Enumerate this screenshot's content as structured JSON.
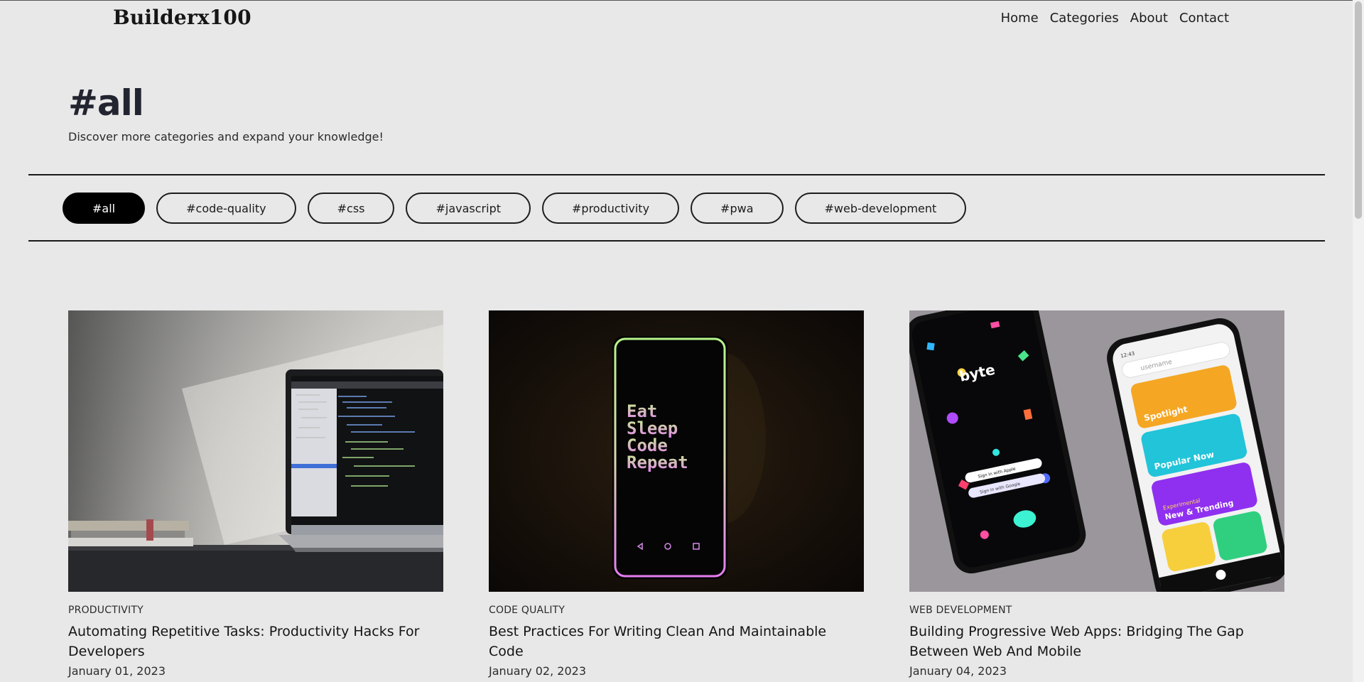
{
  "brand": "Builderx100",
  "nav": {
    "home": "Home",
    "categories": "Categories",
    "about": "About",
    "contact": "Contact"
  },
  "header": {
    "title": "#all",
    "subtitle": "Discover more categories and expand your knowledge!"
  },
  "tags": [
    "#all",
    "#code-quality",
    "#css",
    "#javascript",
    "#productivity",
    "#pwa",
    "#web-development"
  ],
  "cards": [
    {
      "category": "PRODUCTIVITY",
      "title": "Automating Repetitive Tasks: Productivity Hacks For Developers",
      "date": "January 01, 2023"
    },
    {
      "category": "CODE QUALITY",
      "title": "Best Practices For Writing Clean And Maintainable Code",
      "date": "January 02, 2023"
    },
    {
      "category": "WEB DEVELOPMENT",
      "title": "Building Progressive Web Apps: Bridging The Gap Between Web And Mobile",
      "date": "January 04, 2023"
    }
  ],
  "phone_text": {
    "eat": "Eat",
    "sleep": "Sleep",
    "code": "Code",
    "repeat": "Repeat",
    "byte": "byte",
    "apple": "Sign in with Apple",
    "google": "Sign in with Google",
    "time": "12:43",
    "username": "username",
    "spotlight": "Spotlight",
    "popular": "Popular Now",
    "experimental": "Experimental",
    "trending": "New & Trending"
  },
  "colors": {
    "background": "#e8e8e8",
    "active_tag": "#000000",
    "title": "#22252f"
  }
}
